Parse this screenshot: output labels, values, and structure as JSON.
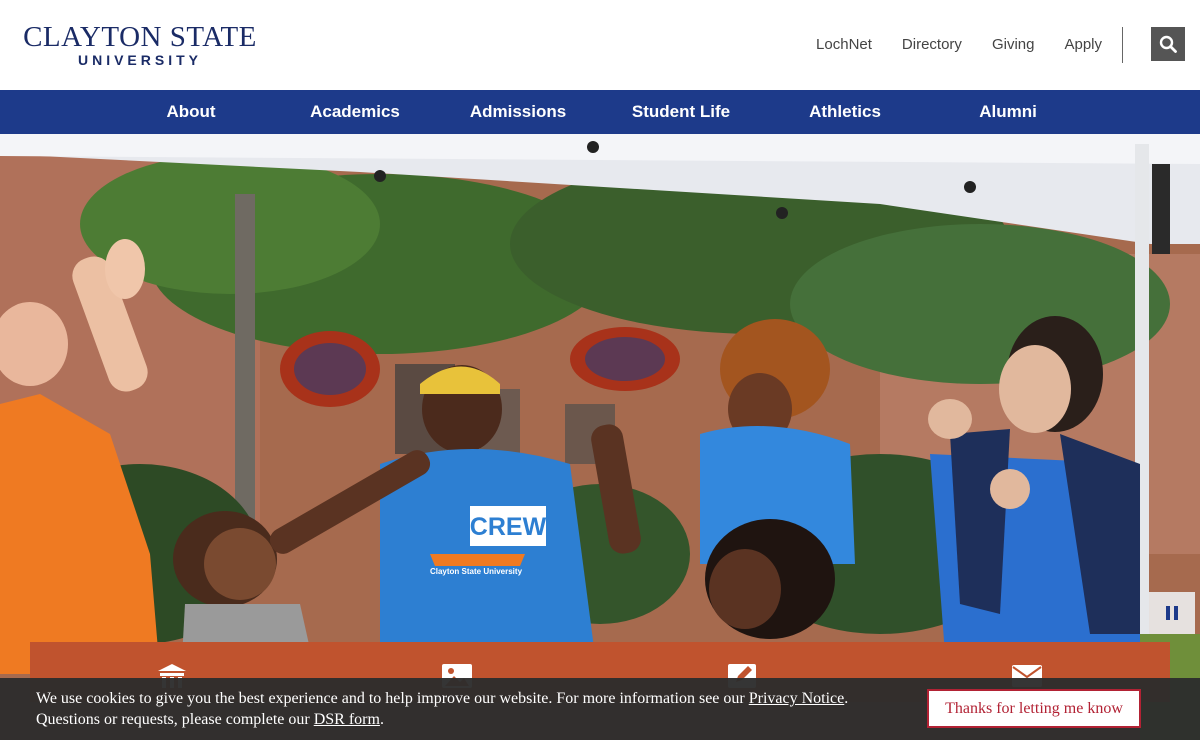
{
  "header": {
    "logo_line1": "CLAYTON STATE",
    "logo_line2": "UNIVERSITY",
    "utility_links": [
      "LochNet",
      "Directory",
      "Giving",
      "Apply"
    ],
    "search_icon": "search-icon"
  },
  "nav": {
    "items": [
      "About",
      "Academics",
      "Admissions",
      "Student Life",
      "Athletics",
      "Alumni"
    ]
  },
  "hero": {
    "shirt_text_1": "CREW",
    "shirt_text_2": "Clayton State University",
    "pause_icon": "pause-icon"
  },
  "quick_links": {
    "icons": [
      "institution-icon",
      "image-icon",
      "pencil-icon",
      "envelope-icon"
    ]
  },
  "cookie": {
    "text_before": "We use cookies to give you the best experience and to help improve our website. For more information see our ",
    "privacy_link": "Privacy Notice",
    "text_middle": ". Questions or requests, please complete our ",
    "dsr_link": "DSR form",
    "text_after": ".",
    "button_label": "Thanks for letting me know"
  },
  "colors": {
    "brand_navy": "#1d3a8a",
    "logo_navy": "#1a2b66",
    "quick_bar_orange": "#c0532e",
    "cookie_button_red": "#b22234"
  }
}
